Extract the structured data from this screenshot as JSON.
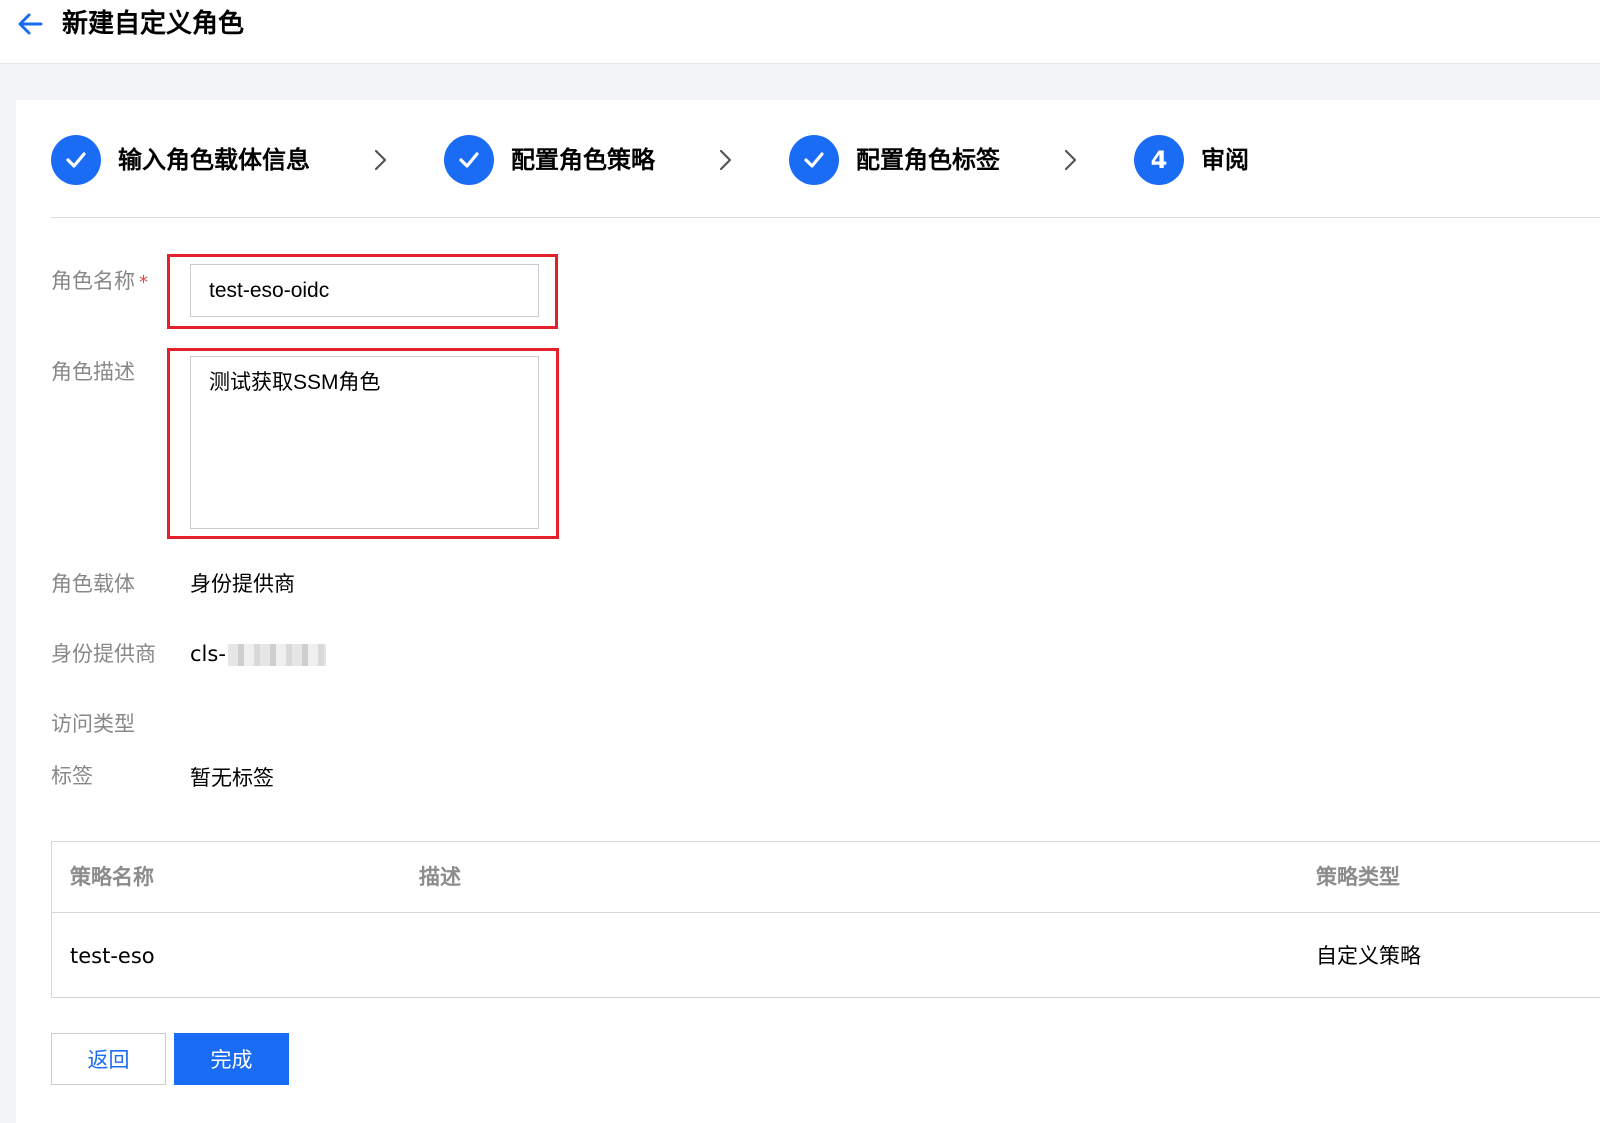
{
  "header": {
    "title": "新建自定义角色",
    "back_icon": "arrow-left-icon"
  },
  "steps": [
    {
      "label": "输入角色载体信息",
      "state": "done",
      "icon": "check-icon"
    },
    {
      "label": "配置角色策略",
      "state": "done",
      "icon": "check-icon"
    },
    {
      "label": "配置角色标签",
      "state": "done",
      "icon": "check-icon"
    },
    {
      "label": "审阅",
      "state": "current",
      "number": "4"
    }
  ],
  "form": {
    "role_name_label": "角色名称",
    "required_mark": "*",
    "role_name_value": "test-eso-oidc",
    "role_desc_label": "角色描述",
    "role_desc_value": "测试获取SSM角色",
    "carrier_label": "角色载体",
    "carrier_value": "身份提供商",
    "provider_label": "身份提供商",
    "provider_value": "cls-",
    "access_type_label": "访问类型",
    "tags_label": "标签",
    "tags_value": "暂无标签"
  },
  "policy_table": {
    "columns": [
      "策略名称",
      "描述",
      "策略类型"
    ],
    "rows": [
      {
        "name": "test-eso",
        "desc": "",
        "type": "自定义策略"
      }
    ]
  },
  "actions": {
    "back_label": "返回",
    "done_label": "完成"
  },
  "colors": {
    "primary": "#1b6cf5",
    "highlight": "#e5202a",
    "required": "#e54545"
  }
}
